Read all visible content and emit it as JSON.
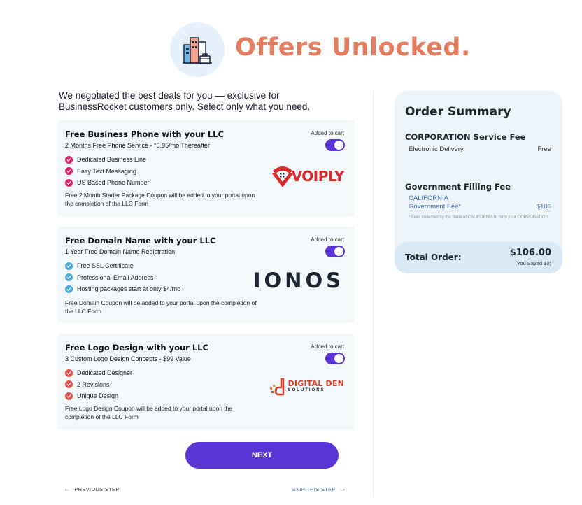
{
  "header": {
    "title": "Offers Unlocked."
  },
  "intro": "We negotiated the best deals for you — exclusive for BusinessRocket customers only. Select only what you need.",
  "offers": [
    {
      "title": "Free Business Phone with your LLC",
      "subtitle": "2 Months Free Phone Service - *5.95/mo Thereafter",
      "features": [
        "Dedicated Business Line",
        "Easy Text Messaging",
        "US Based Phone Number"
      ],
      "note": "Free 2 Month Starter Package Coupon will be added to your portal upon the completion of the LLC Form",
      "cart_label": "Added to cart",
      "toggle_on": true,
      "logo_text": "VOIPLY",
      "check_color": "#e0206a"
    },
    {
      "title": "Free Domain Name with your LLC",
      "subtitle": "1 Year Free Domain Name Registration",
      "features": [
        "Free SSL Certificate",
        "Professional Email Address",
        "Hosting packages start at only $4/mo"
      ],
      "note": "Free Domain Coupon will be added to your portal upon the completion of the LLC Form",
      "cart_label": "Added to cart",
      "toggle_on": true,
      "logo_text": "IONOS",
      "check_color": "#4ba8d8"
    },
    {
      "title": "Free Logo Design with your LLC",
      "subtitle": "3 Custom Logo Design Concepts - $99 Value",
      "features": [
        "Dedicated Designer",
        "2 Revisions",
        "Unique Design"
      ],
      "note": "Free Logo Design Coupon will be added to your portal upon the completion of the LLC Form",
      "cart_label": "Added to cart",
      "toggle_on": true,
      "logo_text": "DIGITAL DEN",
      "logo_subtext": "SOLUTIONS",
      "check_color": "#e0504a"
    }
  ],
  "actions": {
    "next_label": "NEXT",
    "prev_label": "PREVIOUS STEP",
    "skip_label": "SKIP THIS STEP"
  },
  "summary": {
    "title": "Order Summary",
    "service_fee_title": "CORPORATION Service Fee",
    "delivery_label": "Electronic Delivery",
    "delivery_price": "Free",
    "gov_fee_title": "Government Filling Fee",
    "state": "CALIFORNIA",
    "gov_fee_label": "Government Fee*",
    "gov_fee_price": "$106",
    "fine_print": "* Fees collected by the State of CALIFORNIA to form your CORPORATION",
    "total_label": "Total Order:",
    "total_value": "$106.00",
    "saved": "(You Saved $0)"
  },
  "colors": {
    "accent": "#5b35d5",
    "title": "#e47c5e",
    "link": "#3f6fb0"
  }
}
